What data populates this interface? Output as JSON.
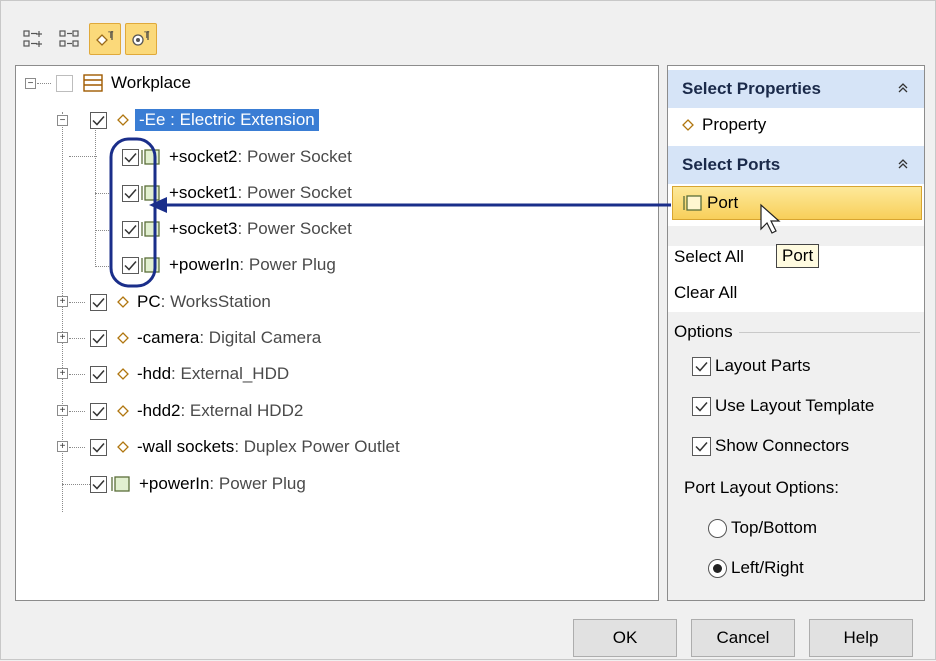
{
  "toolbar": {
    "buttons": [
      {
        "icon": "expand-all-icon",
        "active": false
      },
      {
        "icon": "collapse-all-icon",
        "active": false
      },
      {
        "icon": "show-properties-icon",
        "active": true
      },
      {
        "icon": "show-ports-icon",
        "active": true
      }
    ]
  },
  "tree": {
    "root": {
      "name": "Workplace",
      "checked": false
    },
    "items": [
      {
        "name": "-Ee",
        "type": " : Electric Extension",
        "full": "-Ee : Electric Extension",
        "kind": "property",
        "checked": true,
        "expanded": true,
        "selected": true
      },
      {
        "name": "+socket2",
        "type": " : Power Socket",
        "kind": "port",
        "checked": true
      },
      {
        "name": "+socket1",
        "type": " : Power Socket",
        "kind": "port",
        "checked": true
      },
      {
        "name": "+socket3",
        "type": " : Power Socket",
        "kind": "port",
        "checked": true
      },
      {
        "name": "+powerIn",
        "type": " : Power Plug",
        "kind": "port",
        "checked": true
      },
      {
        "name": "PC",
        "type": " : WorksStation",
        "kind": "property",
        "checked": true
      },
      {
        "name": "-camera",
        "type": " : Digital Camera",
        "kind": "property",
        "checked": true
      },
      {
        "name": "-hdd",
        "type": " : External_HDD",
        "kind": "property",
        "checked": true
      },
      {
        "name": "-hdd2",
        "type": " : External HDD2",
        "kind": "property",
        "checked": true
      },
      {
        "name": "-wall sockets",
        "type": " : Duplex Power Outlet",
        "kind": "property",
        "checked": true
      },
      {
        "name": "+powerIn",
        "type": " : Power Plug",
        "kind": "port",
        "checked": true
      }
    ]
  },
  "side": {
    "select_properties": "Select Properties",
    "property_item": "Property",
    "select_ports": "Select Ports",
    "port_item": "Port",
    "tooltip": "Port",
    "select_all": "Select All",
    "clear_all": "Clear All",
    "options": "Options",
    "layout_parts": "Layout Parts",
    "use_layout_template": "Use Layout Template",
    "show_connectors": "Show Connectors",
    "port_layout_options": "Port Layout Options:",
    "top_bottom": "Top/Bottom",
    "left_right": "Left/Right",
    "checks": {
      "layout_parts": true,
      "use_layout_template": true,
      "show_connectors": true
    },
    "port_layout_selected": "Left/Right"
  },
  "buttons": {
    "ok": "OK",
    "cancel": "Cancel",
    "help": "Help"
  },
  "colors": {
    "selection": "#3a7dd4",
    "section_header": "#d6e4f7",
    "highlight": "#f8cf5a",
    "annotation": "#1a2e8a"
  }
}
